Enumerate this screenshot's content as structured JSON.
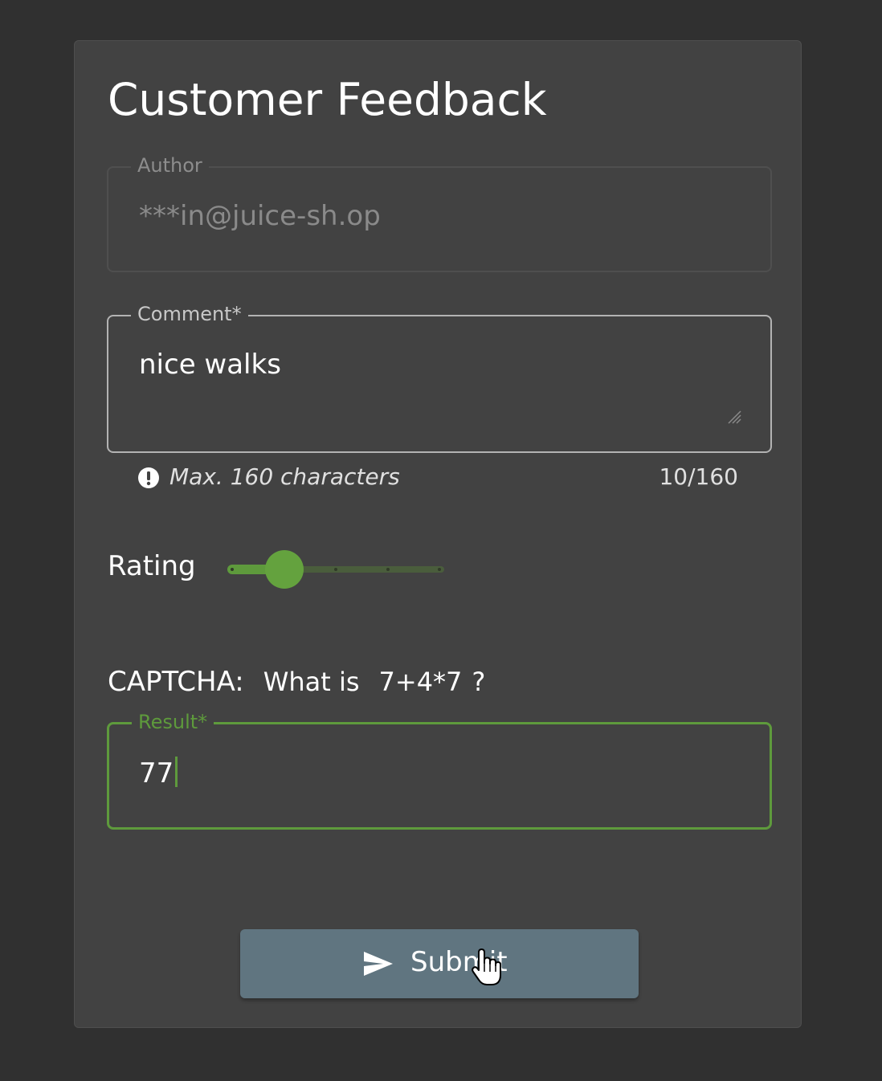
{
  "form": {
    "title": "Customer Feedback",
    "author": {
      "label": "Author",
      "value": "***in@juice-sh.op"
    },
    "comment": {
      "label": "Comment*",
      "value": "nice walks",
      "hint": "Max. 160 characters",
      "counter": "10/160"
    },
    "rating": {
      "label": "Rating",
      "value": 2,
      "min": 1,
      "max": 5
    },
    "captcha": {
      "label": "CAPTCHA:",
      "question": "What is",
      "expression": "7+4*7",
      "question_mark": "?"
    },
    "result": {
      "label": "Result*",
      "value": "77"
    },
    "submit": {
      "label": "Submit",
      "icon": "send-icon"
    }
  },
  "colors": {
    "background": "#303030",
    "card": "#424242",
    "accent": "#5e9a3c",
    "button": "#607580"
  }
}
